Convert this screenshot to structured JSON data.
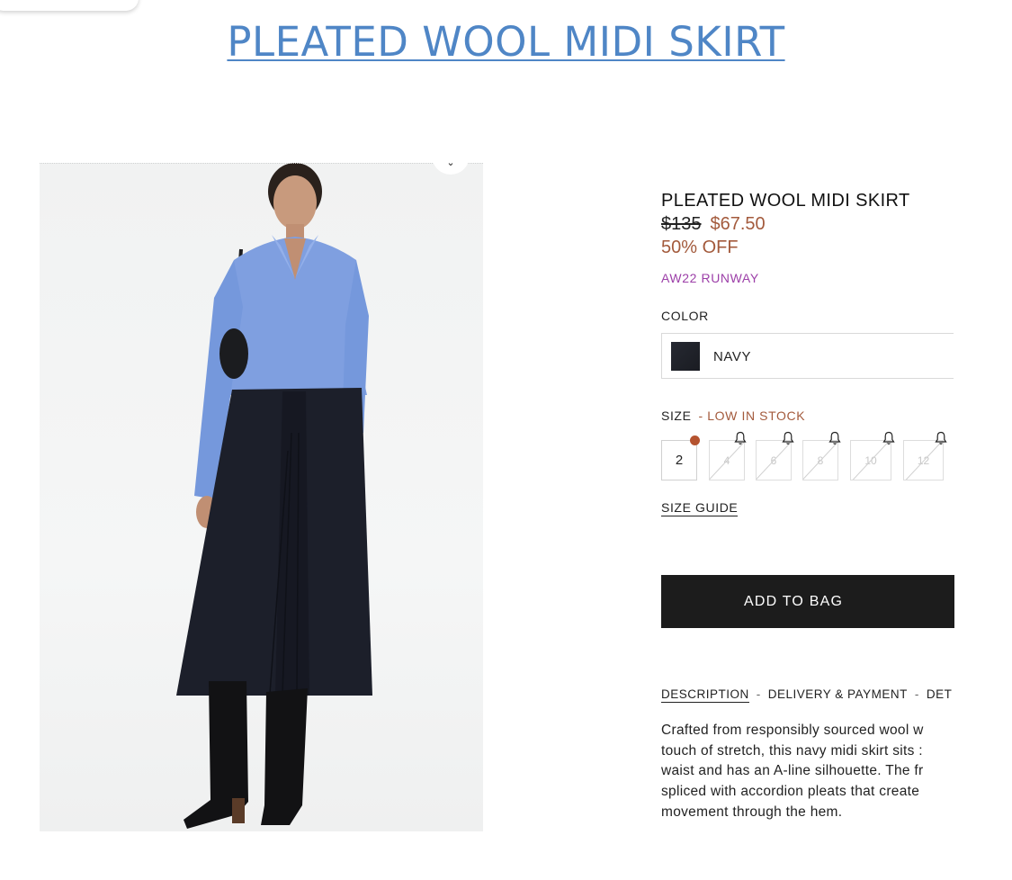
{
  "page": {
    "heading": "PLEATED WOOL MIDI SKIRT"
  },
  "image": {
    "alt": "Model wearing a navy pleated wool midi skirt with a blue button-up shirt and black knee-high boots"
  },
  "product": {
    "title": "PLEATED WOOL MIDI SKIRT",
    "original_price": "$135",
    "sale_price": "$67.50",
    "discount": "50% OFF",
    "collection": "AW22 RUNWAY",
    "color_label": "COLOR",
    "selected_color": "NAVY",
    "swatch_color": "#1f2229",
    "size_label": "SIZE",
    "stock_note": "- LOW IN STOCK",
    "sizes": [
      {
        "label": "2",
        "available": true,
        "low_stock": true
      },
      {
        "label": "4",
        "available": false,
        "notify": true
      },
      {
        "label": "6",
        "available": false,
        "notify": true
      },
      {
        "label": "8",
        "available": false,
        "notify": true
      },
      {
        "label": "10",
        "available": false,
        "notify": true
      },
      {
        "label": "12",
        "available": false,
        "notify": true
      }
    ],
    "size_guide_label": "SIZE GUIDE",
    "add_to_bag_label": "ADD TO BAG"
  },
  "tabs": [
    {
      "label": "DESCRIPTION",
      "active": true
    },
    {
      "label": "DELIVERY & PAYMENT",
      "active": false
    },
    {
      "label": "DET",
      "active": false
    }
  ],
  "description": {
    "lines": [
      "Crafted from responsibly sourced wool w",
      "touch of stretch, this navy midi skirt sits :",
      "waist and has an A-line silhouette. The fr",
      "spliced with accordion pleats that create",
      "movement through the hem."
    ]
  },
  "colors": {
    "heading_link": "#4f86c6",
    "sale": "#a35a3c",
    "collection": "#9c3fa8",
    "button_bg": "#1c1c1c",
    "low_stock_dot": "#b5532f"
  }
}
